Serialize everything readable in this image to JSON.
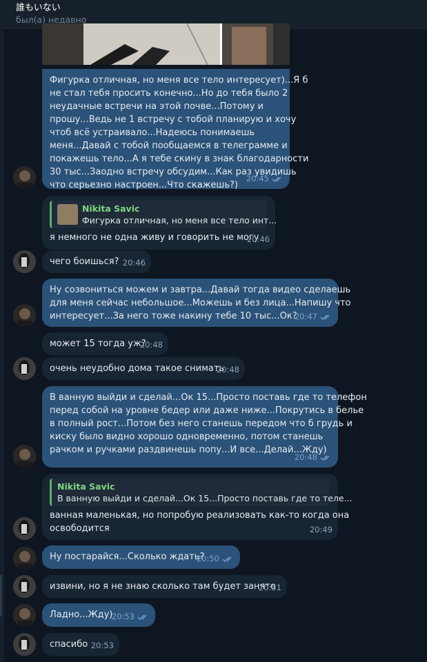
{
  "header": {
    "title": "誰もいない",
    "status": "был(а) недавно"
  },
  "messages": [
    {
      "id": "m1",
      "lines": [
        "Фигурка отличная, но меня все тело интересует)...Я б",
        "не стал тебя просить конечно...Но до тебя было 2",
        "неудачные встречи на этой почве...Потому и",
        "прошу...Ведь не 1 встречу с тобой планирую и хочу",
        "чтоб всё устраивало...Надеюсь понимаешь",
        "меня...Давай с тобой пообщаемся в  телеграмме и",
        "покажешь тело...А я тебе скину в знак благодарности",
        "30 тыс...Заодно встречу обсудим...Как раз увидишь",
        "что серьезно настроен...Что скажешь?)"
      ],
      "time": "20:45"
    },
    {
      "id": "m2",
      "reply_name": "Nikita Savic",
      "reply_text": "Фигурка отличная, но меня все тело инт...",
      "text": "я немного не одна живу и говорить не могу",
      "time": "20:46"
    },
    {
      "id": "m3",
      "text": "чего боишься?",
      "time": "20:46"
    },
    {
      "id": "m4",
      "lines": [
        "Ну созвониться можем и завтра...Давай тогда видео сделаешь",
        "для меня сейчас небольшое...Можешь и без лица...Напишу что",
        "интересует...За него тоже накину тебе 10 тыс...Ок?"
      ],
      "time": "20:47"
    },
    {
      "id": "m5",
      "text": "может 15 тогда уж?",
      "time": "20:48"
    },
    {
      "id": "m6",
      "text": "очень неудобно дома такое снимать",
      "time": "20:48"
    },
    {
      "id": "m7",
      "lines": [
        "В ванную выйди и сделай...Ок 15...Просто поставь где то телефон",
        "перед собой на уровне бедер или даже ниже...Покрутись в белье",
        "в полный рост...Потом без него станешь передом что б грудь и",
        "киску было видно хорошо одновременно, потом станешь",
        "рачком и ручками раздвинешь попу...И все...Делай...Жду)"
      ],
      "time": "20:48"
    },
    {
      "id": "m8",
      "reply_name": "Nikita Savic",
      "reply_text": "В ванную выйди и сделай...Ок 15...Просто поставь где то теле...",
      "lines": [
        "ванная маленькая, но попробую реализовать как-то когда она",
        "освободится"
      ],
      "time": "20:49"
    },
    {
      "id": "m9",
      "text": "Ну постарайся...Сколько ждать?",
      "time": "20:50"
    },
    {
      "id": "m10",
      "text": "извини, но я не знаю сколько там будет занято",
      "time": "20:51"
    },
    {
      "id": "m11",
      "text": "Ладно...Жду)",
      "time": "20:53"
    },
    {
      "id": "m12",
      "text": "спасибо",
      "time": "20:53"
    }
  ]
}
